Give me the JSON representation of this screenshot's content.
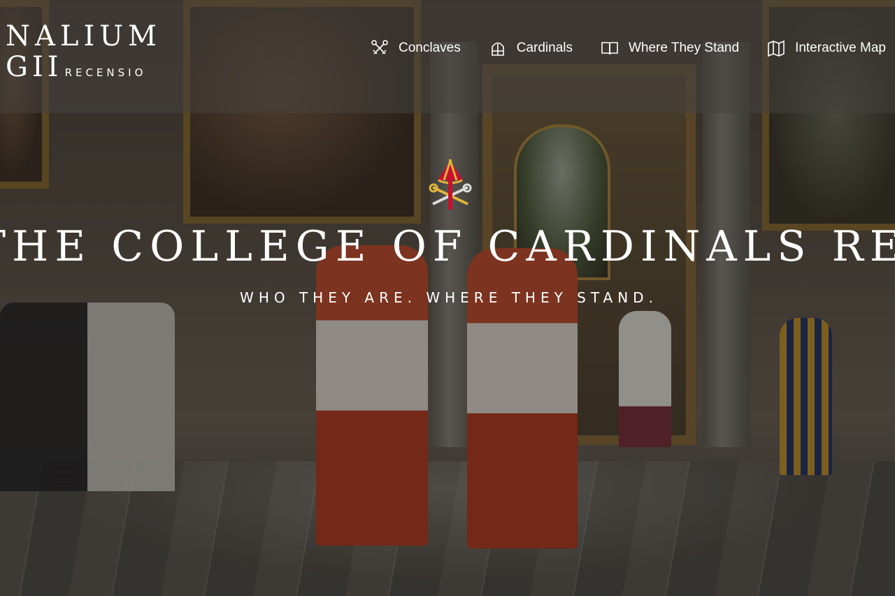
{
  "brand": {
    "line1": "NALIUM",
    "line2": "GII",
    "subtitle": "RECENSIO"
  },
  "nav": {
    "items": [
      {
        "label": "Conclaves",
        "icon": "crossed-keys-icon"
      },
      {
        "label": "Cardinals",
        "icon": "mitre-icon"
      },
      {
        "label": "Where They Stand",
        "icon": "open-book-icon"
      },
      {
        "label": "Interactive Map",
        "icon": "map-icon"
      }
    ]
  },
  "hero": {
    "title": "THE COLLEGE OF CARDINALS REPORT",
    "subtitle": "WHO THEY ARE. WHERE THEY STAND.",
    "emblem": "papal-keys-emblem-icon"
  },
  "colors": {
    "header_overlay": "#46423e",
    "text": "#ffffff",
    "emblem_red": "#c8102e",
    "emblem_gold": "#e0b43c"
  }
}
